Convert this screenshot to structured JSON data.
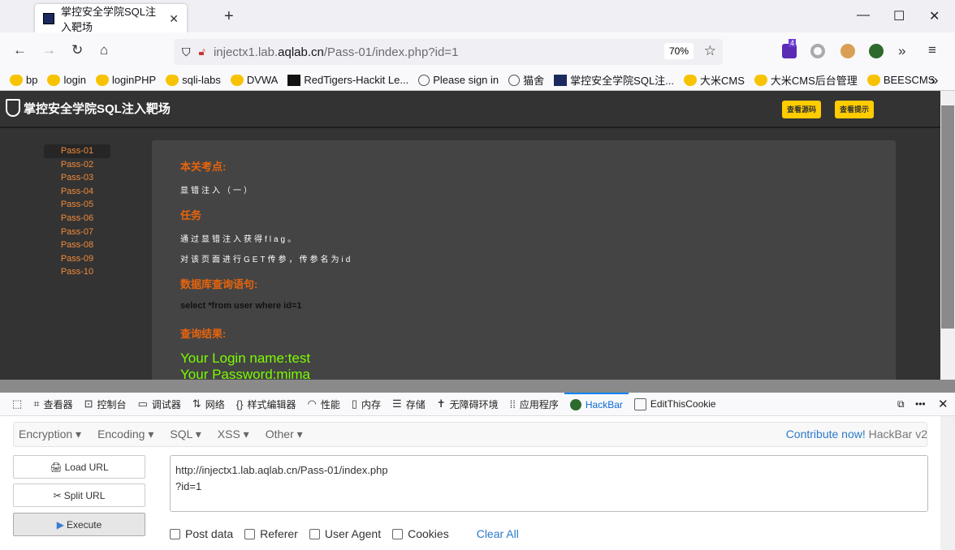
{
  "browser": {
    "tab_title": "掌控安全学院SQL注入靶场",
    "new_tab": "+",
    "url_prefix": "injectx1.lab.",
    "url_domain": "aqlab.cn",
    "url_path": "/Pass-01/index.php?id=1",
    "zoom": "70%",
    "ext_badge": "4",
    "bookmarks": [
      "bp",
      "login",
      "loginPHP",
      "sqli-labs",
      "DVWA",
      "RedTigers-Hackit Le...",
      "Please sign in",
      "猫舍",
      "掌控安全学院SQL注...",
      "大米CMS",
      "大米CMS后台管理",
      "BEESCMS"
    ]
  },
  "page": {
    "logo": "掌控安全学院SQL注入靶场",
    "btn_source": "查看源码",
    "btn_hint": "查看提示",
    "passes": [
      "Pass-01",
      "Pass-02",
      "Pass-03",
      "Pass-04",
      "Pass-05",
      "Pass-06",
      "Pass-07",
      "Pass-08",
      "Pass-09",
      "Pass-10"
    ],
    "h_point": "本关考点:",
    "point": "显错注入（一）",
    "h_task": "任务",
    "task1": "通过显错注入获得flag。",
    "task2": "对该页面进行GET传参，传参名为id",
    "h_query": "数据库查询语句:",
    "query": "select *from user where id=1",
    "h_result": "查询结果:",
    "result1": "Your Login name:test",
    "result2": "Your Password:mima"
  },
  "devtools": {
    "tabs": [
      "查看器",
      "控制台",
      "调试器",
      "网络",
      "样式编辑器",
      "性能",
      "内存",
      "存储",
      "无障碍环境",
      "应用程序",
      "HackBar",
      "EditThisCookie"
    ]
  },
  "hackbar": {
    "menu": [
      "Encryption ▾",
      "Encoding ▾",
      "SQL ▾",
      "XSS ▾",
      "Other ▾"
    ],
    "contribute": "Contribute now!",
    "version": " HackBar v2",
    "load": "Load URL",
    "split": "Split URL",
    "execute": "Execute",
    "url_value": "http://injectx1.lab.aqlab.cn/Pass-01/index.php\n?id=1",
    "checks": [
      "Post data",
      "Referer",
      "User Agent",
      "Cookies"
    ],
    "clear": "Clear All"
  }
}
